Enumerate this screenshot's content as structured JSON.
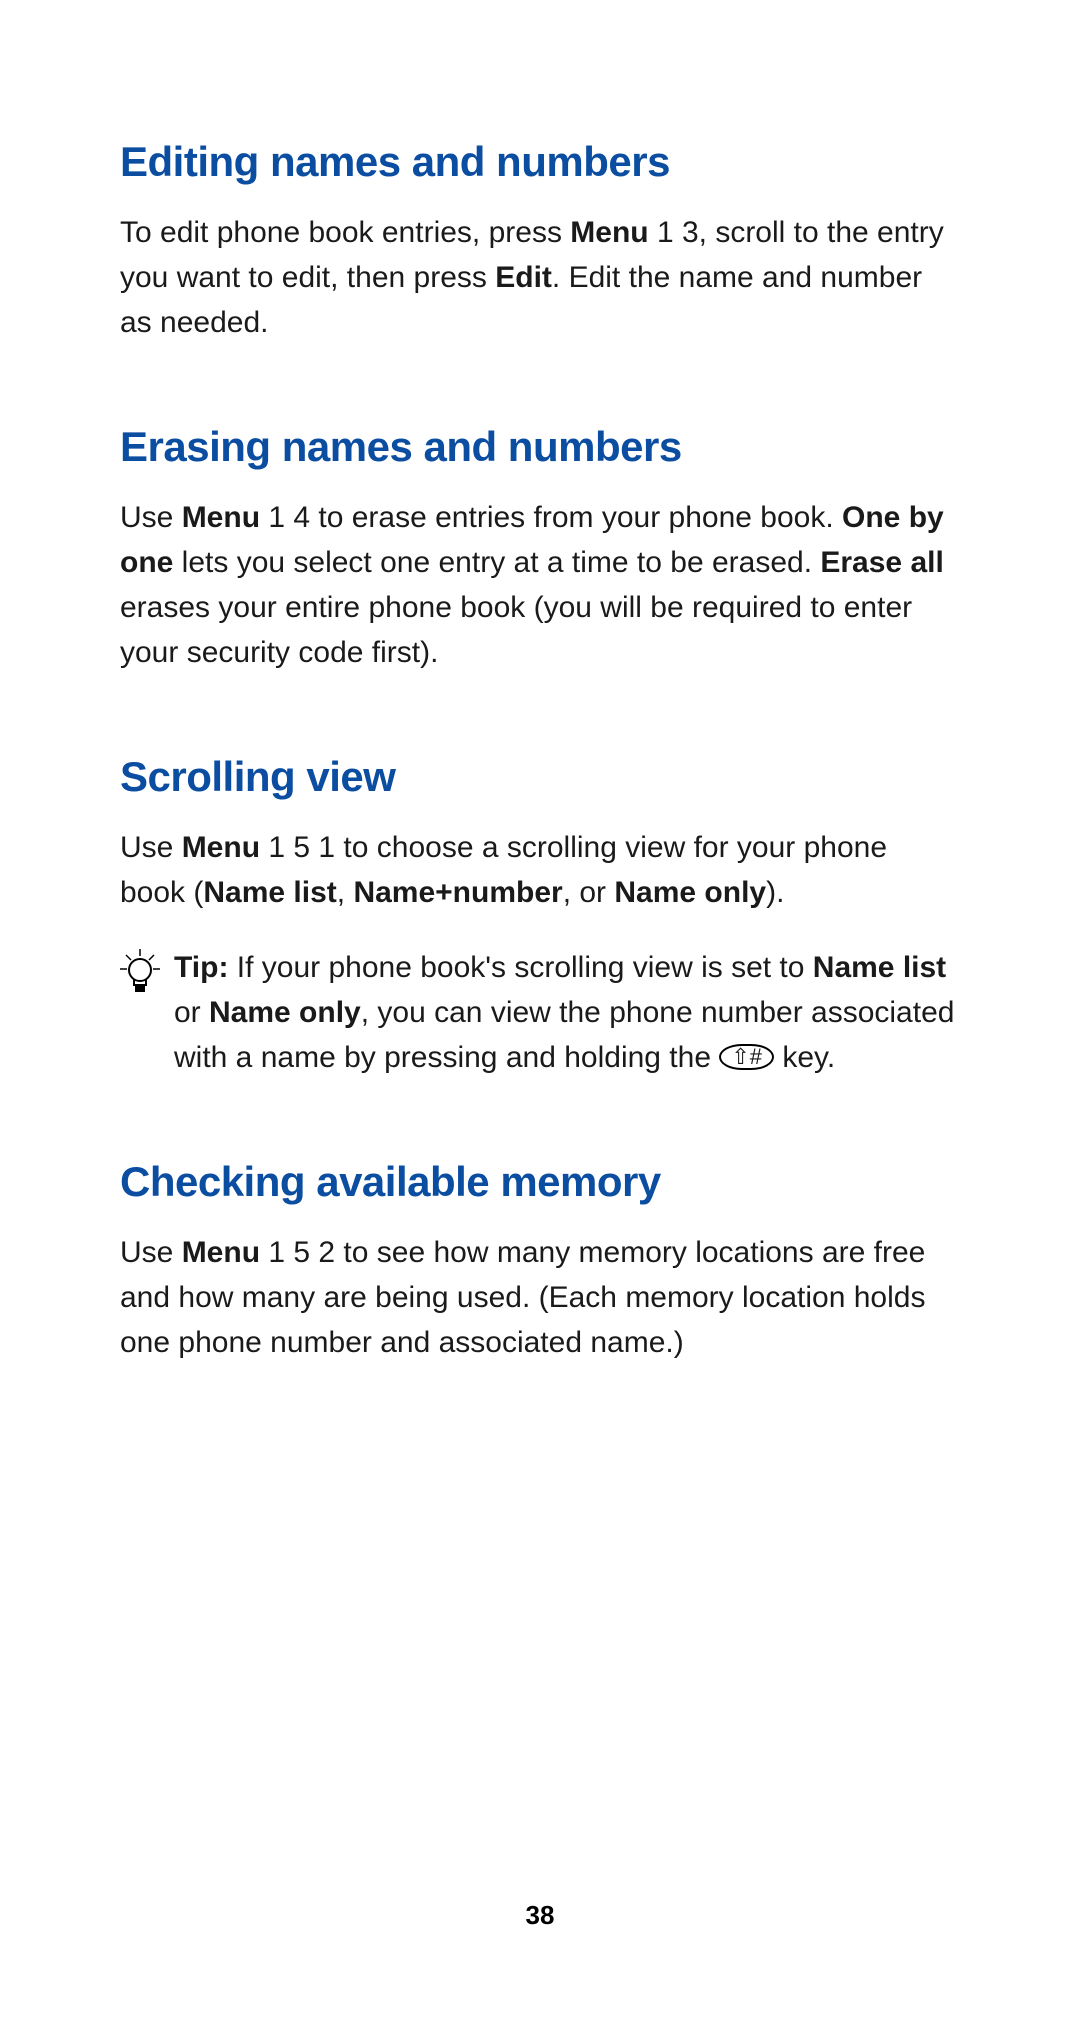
{
  "sections": {
    "editing": {
      "heading": "Editing names and numbers",
      "p1_pre": "To edit phone book entries, press ",
      "p1_b1": "Menu",
      "p1_mid1": " 1 3, scroll to the entry you want to edit, then press ",
      "p1_b2": "Edit",
      "p1_post": ". Edit the name and number as needed."
    },
    "erasing": {
      "heading": "Erasing names and numbers",
      "p1_pre": "Use ",
      "p1_b1": "Menu",
      "p1_mid1": " 1 4 to erase entries from your phone book. ",
      "p1_b2": "One by one",
      "p1_mid2": " lets you select one entry at a time to be erased. ",
      "p1_b3": "Erase all",
      "p1_post": " erases your entire phone book (you will be required to enter your security code first)."
    },
    "scrolling": {
      "heading": "Scrolling view",
      "p1_pre": "Use ",
      "p1_b1": "Menu",
      "p1_mid1": " 1 5 1 to choose a scrolling view for your phone book (",
      "p1_b2": "Name list",
      "p1_mid2": ", ",
      "p1_b3": "Name+number",
      "p1_mid3": ", or ",
      "p1_b4": "Name only",
      "p1_post": ").",
      "tip_label": "Tip:",
      "tip_pre": "  If your phone book's scrolling view is set to ",
      "tip_b1": "Name list",
      "tip_mid1": " or ",
      "tip_b2": "Name only",
      "tip_mid2": ", you can view the phone number associated with a name by pressing and holding the ",
      "tip_key": "⇧#",
      "tip_post": " key."
    },
    "memory": {
      "heading": "Checking available memory",
      "p1_pre": "Use ",
      "p1_b1": "Menu",
      "p1_post": " 1 5 2 to see how many memory locations are free and how many are being used. (Each memory location holds one phone number and associated name.)"
    }
  },
  "page_number": "38"
}
